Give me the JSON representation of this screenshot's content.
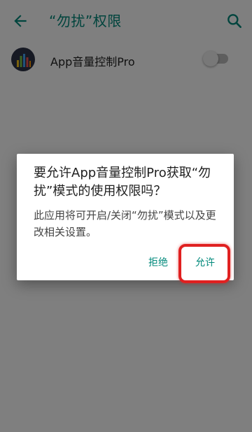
{
  "appbar": {
    "title": "“勿扰”权限"
  },
  "setting": {
    "app_name": "App音量控制Pro",
    "toggle_on": false
  },
  "dialog": {
    "title": "要允许App音量控制Pro获取“勿扰”模式的使用权限吗？",
    "message": "此应用将可开启/关闭“勿扰”模式以及更改相关设置。",
    "deny_label": "拒绝",
    "allow_label": "允许"
  },
  "colors": {
    "accent": "#00897b",
    "highlight": "#e02020"
  },
  "icons": {
    "back": "arrow-back-icon",
    "search": "search-icon",
    "app": "equalizer-app-icon"
  }
}
